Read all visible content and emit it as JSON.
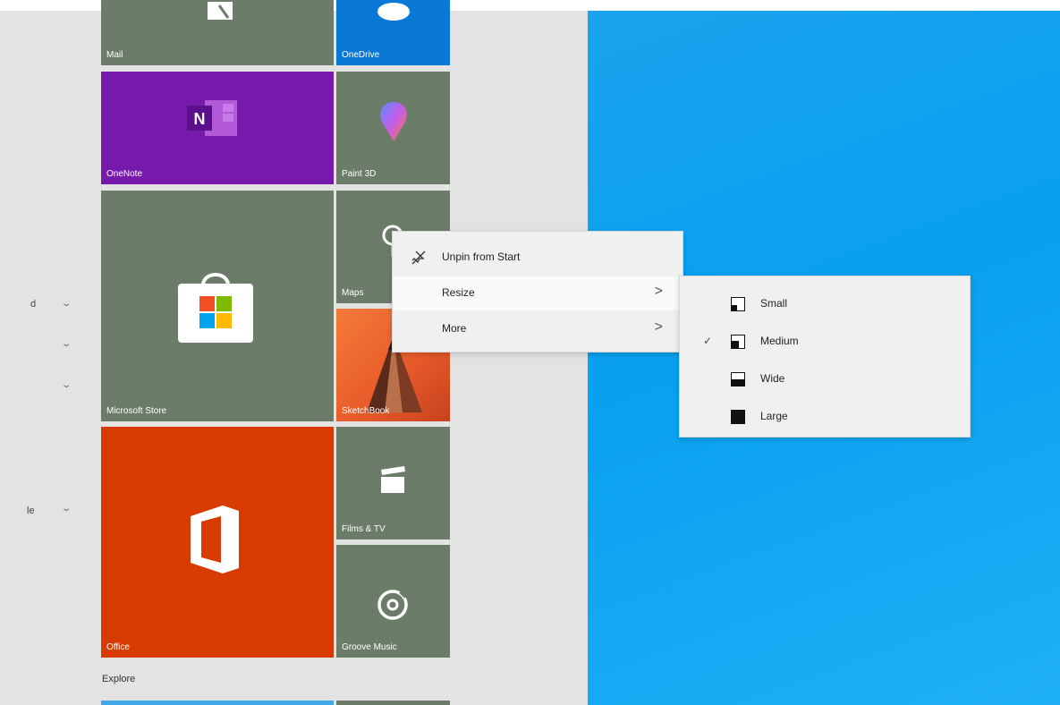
{
  "sidebar": {
    "fragments": [
      "d",
      "le"
    ]
  },
  "tiles": {
    "mail": "Mail",
    "onedrive": "OneDrive",
    "onenote": "OneNote",
    "paint3d": "Paint 3D",
    "store": "Microsoft Store",
    "maps": "Maps",
    "sketchbook": "SketchBook",
    "office": "Office",
    "films": "Films & TV",
    "groove": "Groove Music",
    "onenote_glyph": "N"
  },
  "section": {
    "explore": "Explore"
  },
  "context_menu": {
    "unpin": "Unpin from Start",
    "resize": "Resize",
    "more": "More",
    "arrow": ">"
  },
  "resize_menu": {
    "options": [
      "Small",
      "Medium",
      "Wide",
      "Large"
    ],
    "selected": "Medium",
    "check": "✓"
  },
  "colors": {
    "tile_green": "#6b7d68",
    "onenote_purple": "#7719aa",
    "onedrive_blue": "#0a78d7",
    "office_red": "#d83b01",
    "desktop_blue": "#0aa2f0"
  }
}
